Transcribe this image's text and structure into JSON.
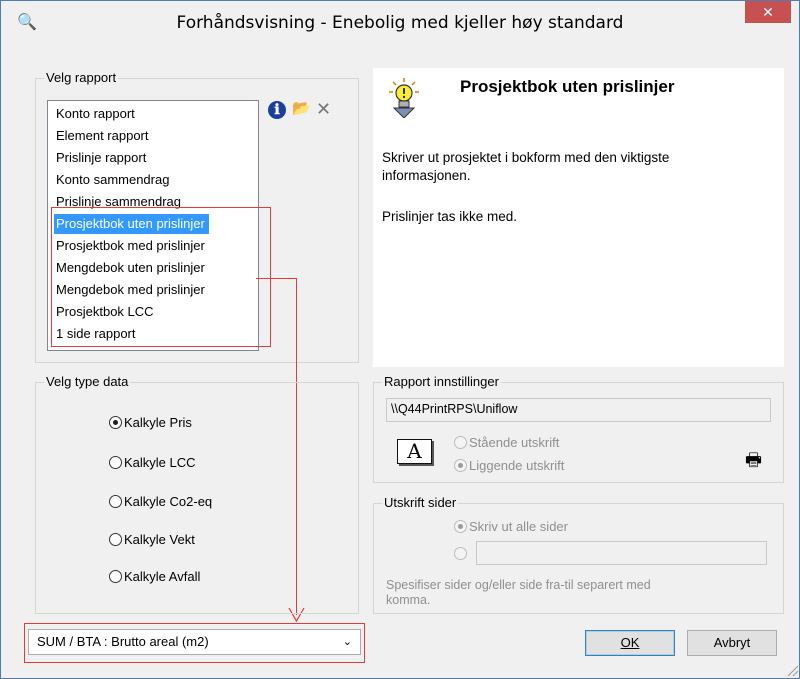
{
  "window": {
    "title": "Forhåndsvisning - Enebolig med kjeller høy standard",
    "close_glyph": "✕",
    "app_icon": "magnifier-icon",
    "app_icon_glyph": "🔍"
  },
  "report_group": {
    "label": "Velg rapport",
    "items": [
      "Konto rapport",
      "Element rapport",
      "Prislinje rapport",
      "Konto sammendrag",
      "Prislinje sammendrag",
      "Prosjektbok uten prislinjer",
      "Prosjektbok med prislinjer",
      "Mengdebok uten prislinjer",
      "Mengdebok med prislinjer",
      "Prosjektbok LCC",
      "1 side rapport"
    ],
    "selected_index": 5,
    "toolbar": {
      "info_glyph": "ℹ",
      "open_glyph": "📂",
      "delete_glyph": "✕"
    }
  },
  "description": {
    "title": "Prosjektbok uten prislinjer",
    "text1": "Skriver ut prosjektet i bokform med den viktigste",
    "text2": "informasjonen.",
    "text3": "Prislinjer tas ikke med.",
    "icon": "lightbulb-icon"
  },
  "data_type_group": {
    "label": "Velg type data",
    "options": [
      "Kalkyle Pris",
      "Kalkyle LCC",
      "Kalkyle Co2-eq",
      "Kalkyle Vekt",
      "Kalkyle Avfall"
    ],
    "selected_index": 0
  },
  "report_settings": {
    "label": "Rapport innstillinger",
    "printer": "\\\\Q44PrintRPS\\Uniflow",
    "portrait_label": "Stående utskrift",
    "landscape_label": "Liggende utskrift",
    "orientation": "landscape",
    "page_icon_letter": "A",
    "printer_glyph": "🖶"
  },
  "print_pages": {
    "label": "Utskrift sider",
    "all_pages_label": "Skriv ut alle sider",
    "pages_value": "",
    "hint_line1": "Spesifiser sider og/eller side fra-til separert med",
    "hint_line2": "komma."
  },
  "footer": {
    "dropdown_value": "SUM / BTA : Brutto areal (m2)",
    "dropdown_arrow": "⌄",
    "ok_label": "OK",
    "cancel_label": "Avbryt"
  },
  "colors": {
    "selection": "#3399ff",
    "annotation_red": "#e23b3b",
    "close_button": "#c75050"
  }
}
